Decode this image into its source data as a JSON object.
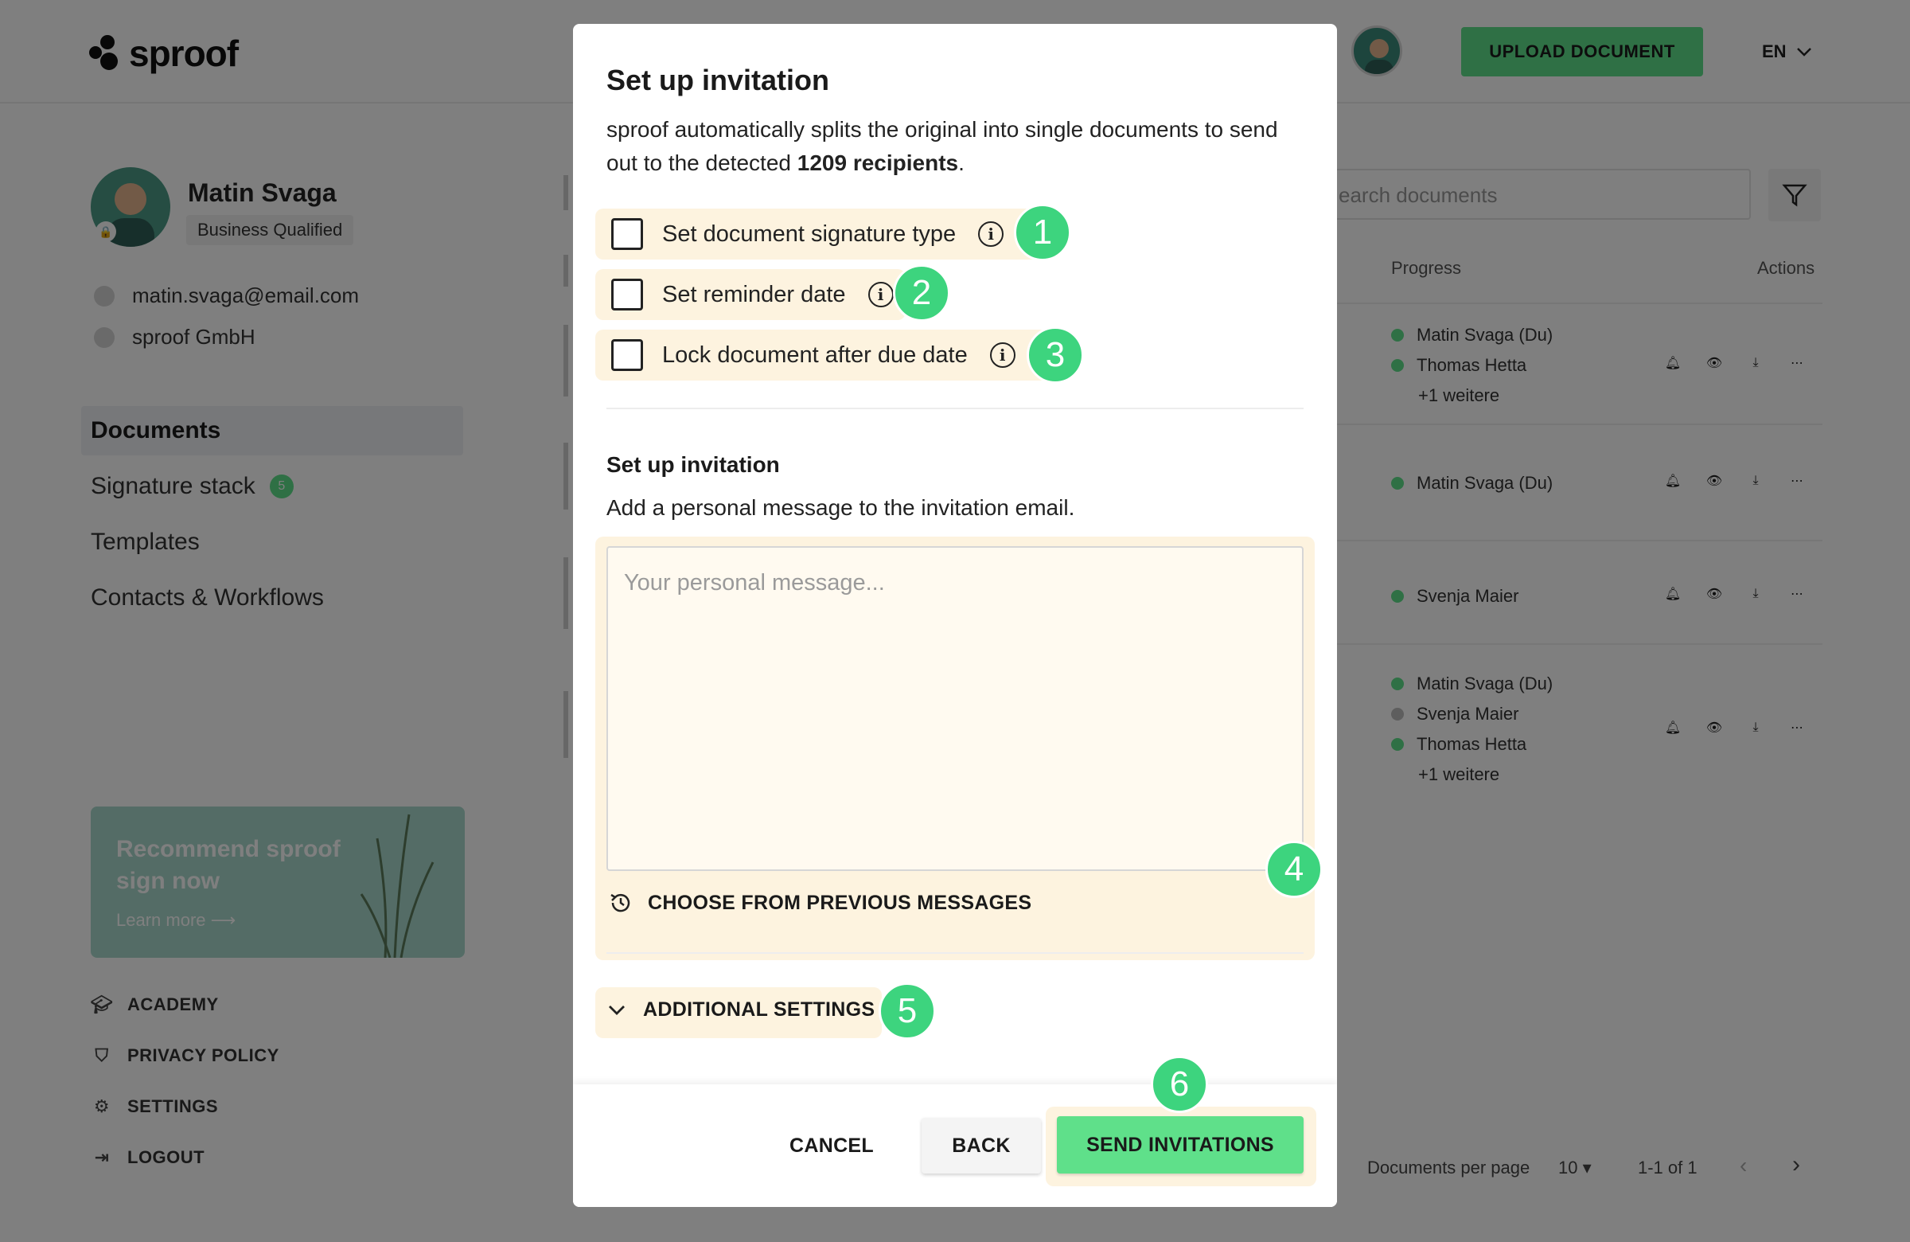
{
  "app": {
    "logo_text": "sproof",
    "upload_button": "UPLOAD DOCUMENT",
    "language": "EN"
  },
  "profile": {
    "name": "Matin Svaga",
    "badge": "Business Qualified",
    "email": "matin.svaga@email.com",
    "company": "sproof GmbH"
  },
  "nav": {
    "items": [
      {
        "label": "Documents",
        "active": true
      },
      {
        "label": "Signature stack",
        "badge": "5"
      },
      {
        "label": "Templates"
      },
      {
        "label": "Contacts & Workflows"
      }
    ]
  },
  "promo": {
    "title": "Recommend sproof sign now",
    "link": "Learn more"
  },
  "footer_links": [
    "ACADEMY",
    "PRIVACY POLICY",
    "SETTINGS",
    "LOGOUT"
  ],
  "documents": {
    "search_placeholder": "earch documents",
    "columns": {
      "progress": "Progress",
      "actions": "Actions"
    },
    "rows": [
      {
        "people": [
          {
            "name": "Matin Svaga (Du)",
            "status": "done"
          },
          {
            "name": "Thomas Hetta",
            "status": "done"
          }
        ],
        "more": "+1 weitere"
      },
      {
        "people": [
          {
            "name": "Matin Svaga (Du)",
            "status": "done"
          }
        ]
      },
      {
        "people": [
          {
            "name": "Svenja Maier",
            "status": "done"
          }
        ]
      },
      {
        "people": [
          {
            "name": "Matin Svaga (Du)",
            "status": "done"
          },
          {
            "name": "Svenja Maier",
            "status": "pending"
          },
          {
            "name": "Thomas Hetta",
            "status": "done"
          }
        ],
        "more": "+1 weitere"
      }
    ],
    "pagination": {
      "per_page_label": "Documents per page",
      "per_page_value": "10",
      "range": "1-1 of 1"
    }
  },
  "modal": {
    "title": "Set up invitation",
    "description_pre": "sproof automatically splits the original into single documents to send out to the detected ",
    "description_bold": "1209 recipients",
    "description_post": ".",
    "options": [
      {
        "label": "Set document signature type",
        "checked": false,
        "step": "1"
      },
      {
        "label": "Set reminder date",
        "checked": false,
        "step": "2"
      },
      {
        "label": "Lock document after due date",
        "checked": false,
        "step": "3"
      }
    ],
    "invitation_section_title": "Set up invitation",
    "invitation_section_subtitle": "Add a personal message to the invitation email.",
    "message_placeholder": "Your personal message...",
    "message_value": "",
    "message_step": "4",
    "previous_messages_label": "CHOOSE FROM PREVIOUS MESSAGES",
    "additional_settings_label": "ADDITIONAL SETTINGS",
    "additional_settings_step": "5",
    "buttons": {
      "cancel": "CANCEL",
      "back": "BACK",
      "send": "SEND INVITATIONS",
      "send_step": "6"
    }
  },
  "colors": {
    "accent": "#5fe08a",
    "step_badge": "#3dd47e",
    "highlight": "#fdf3df"
  }
}
